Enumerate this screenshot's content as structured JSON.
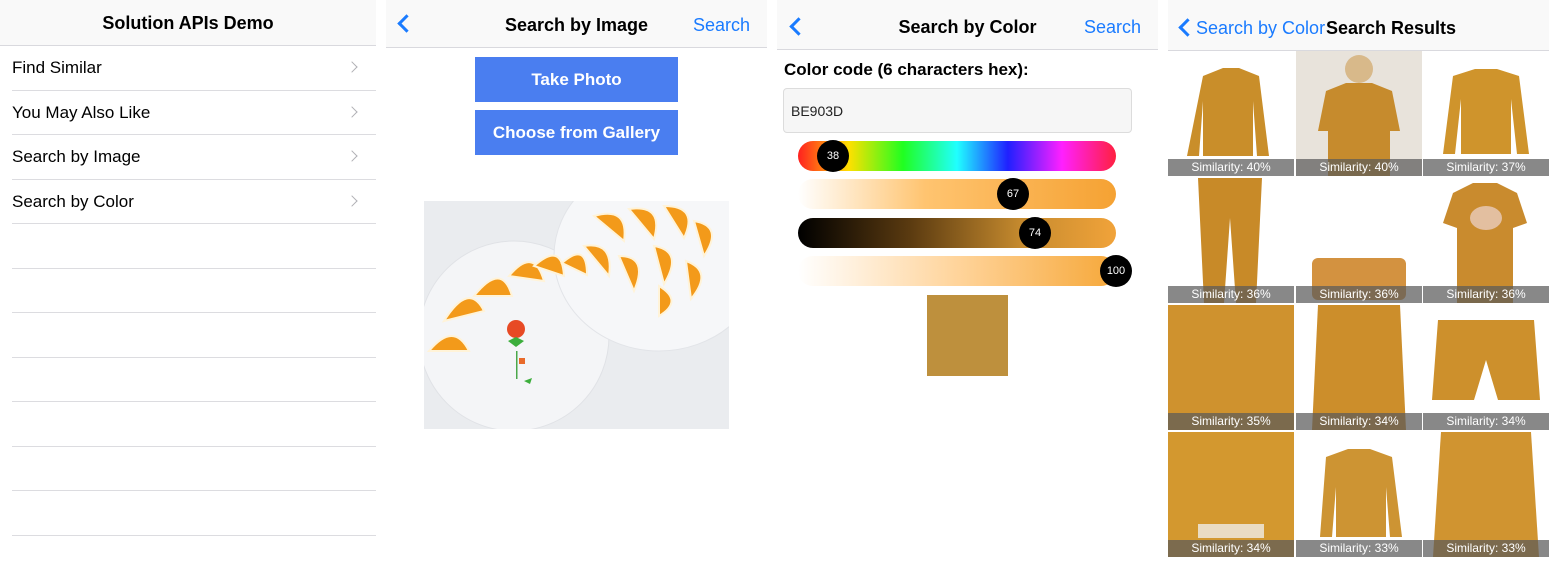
{
  "list_screen": {
    "title": "Solution APIs Demo",
    "items": [
      {
        "label": "Find Similar"
      },
      {
        "label": "You May Also Like"
      },
      {
        "label": "Search by Image"
      },
      {
        "label": "Search by Color"
      }
    ]
  },
  "image_screen": {
    "title": "Search by Image",
    "action": "Search",
    "take_photo": "Take Photo",
    "choose_gallery": "Choose from Gallery"
  },
  "color_screen": {
    "title": "Search by Color",
    "action": "Search",
    "label": "Color code (6 characters hex):",
    "hex_value": "BE903D",
    "hue": "38",
    "saturation": "67",
    "brightness": "74",
    "alpha": "100",
    "swatch_color": "#be903d"
  },
  "results_screen": {
    "back_label": "Search by Color",
    "title": "Search Results",
    "results": [
      {
        "similarity": "Similarity: 40%"
      },
      {
        "similarity": "Similarity: 40%"
      },
      {
        "similarity": "Similarity: 37%"
      },
      {
        "similarity": "Similarity: 36%"
      },
      {
        "similarity": "Similarity: 36%"
      },
      {
        "similarity": "Similarity: 36%"
      },
      {
        "similarity": "Similarity: 35%"
      },
      {
        "similarity": "Similarity: 34%"
      },
      {
        "similarity": "Similarity: 34%"
      },
      {
        "similarity": "Similarity: 34%"
      },
      {
        "similarity": "Similarity: 33%"
      },
      {
        "similarity": "Similarity: 33%"
      }
    ]
  },
  "colors": {
    "accent": "#1a7bff",
    "button": "#4a7ef0",
    "product": "#c9922f"
  }
}
